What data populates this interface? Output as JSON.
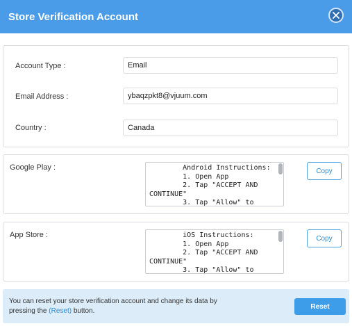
{
  "dialog": {
    "title": "Store Verification Account",
    "close_icon": "close-icon"
  },
  "account": {
    "type_label": "Account Type :",
    "type_value": "Email",
    "email_label": "Email Address :",
    "email_value": "ybaqzpkt8@vjuum.com",
    "country_label": "Country :",
    "country_value": "Canada"
  },
  "google_play": {
    "label": "Google Play :",
    "instructions": "        Android Instructions:\n        1. Open App\n        2. Tap \"ACCEPT AND\nCONTINUE\"\n        3. Tap \"Allow\" to",
    "copy_label": "Copy"
  },
  "app_store": {
    "label": "App Store :",
    "instructions": "        iOS Instructions:\n        1. Open App\n        2. Tap \"ACCEPT AND\nCONTINUE\"\n        3. Tap \"Allow\" to",
    "copy_label": "Copy"
  },
  "footer": {
    "text_before": "You can reset your store verification account and change its data by pressing the ",
    "link_text": "(Reset)",
    "text_after": " button.",
    "reset_label": "Reset"
  },
  "colors": {
    "header": "#4a9be8",
    "accent": "#2a8bd4",
    "footer_bg": "#dcecf8",
    "reset_button": "#3d9de8"
  }
}
